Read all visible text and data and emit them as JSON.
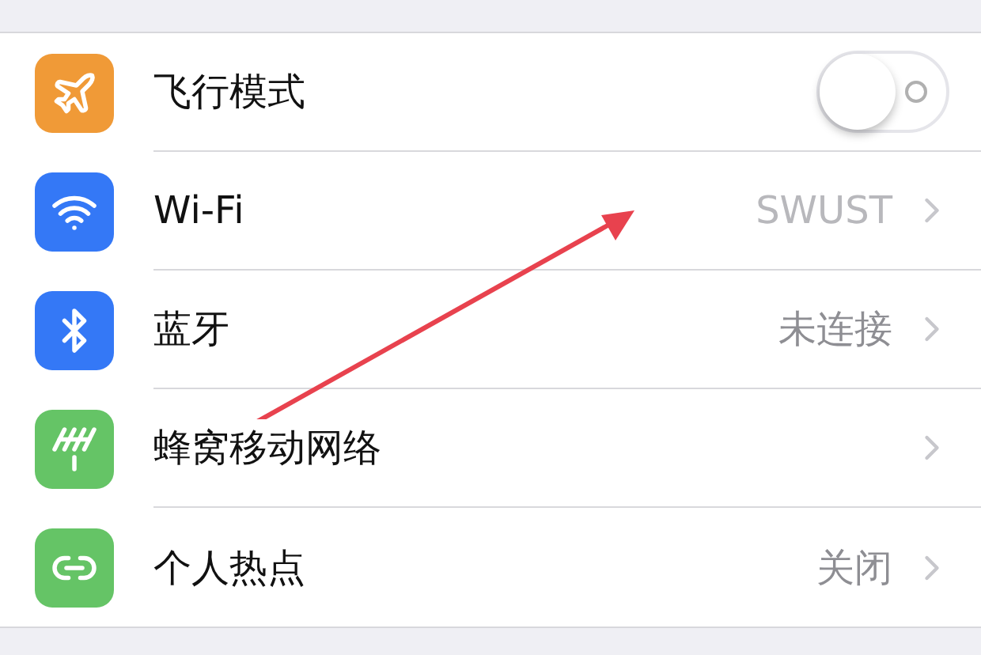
{
  "rows": [
    {
      "kind": "toggle",
      "label": "飞行模式",
      "color": "#f09a37",
      "on": false
    },
    {
      "kind": "link",
      "label": "Wi-Fi",
      "color": "#3478f6",
      "value": "SWUST"
    },
    {
      "kind": "link",
      "label": "蓝牙",
      "color": "#3478f6",
      "value": "未连接"
    },
    {
      "kind": "link",
      "label": "蜂窝移动网络",
      "color": "#65c466"
    },
    {
      "kind": "link",
      "label": "个人热点",
      "color": "#65c466",
      "value": "关闭"
    }
  ]
}
